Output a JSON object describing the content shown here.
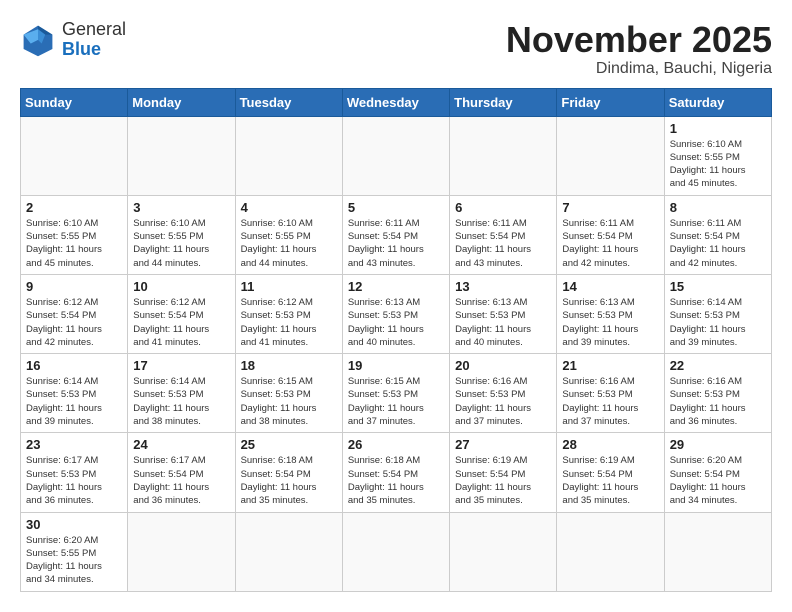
{
  "header": {
    "logo_general": "General",
    "logo_blue": "Blue",
    "month_year": "November 2025",
    "location": "Dindima, Bauchi, Nigeria"
  },
  "weekdays": [
    "Sunday",
    "Monday",
    "Tuesday",
    "Wednesday",
    "Thursday",
    "Friday",
    "Saturday"
  ],
  "weeks": [
    [
      {
        "day": "",
        "info": ""
      },
      {
        "day": "",
        "info": ""
      },
      {
        "day": "",
        "info": ""
      },
      {
        "day": "",
        "info": ""
      },
      {
        "day": "",
        "info": ""
      },
      {
        "day": "",
        "info": ""
      },
      {
        "day": "1",
        "info": "Sunrise: 6:10 AM\nSunset: 5:55 PM\nDaylight: 11 hours\nand 45 minutes."
      }
    ],
    [
      {
        "day": "2",
        "info": "Sunrise: 6:10 AM\nSunset: 5:55 PM\nDaylight: 11 hours\nand 45 minutes."
      },
      {
        "day": "3",
        "info": "Sunrise: 6:10 AM\nSunset: 5:55 PM\nDaylight: 11 hours\nand 44 minutes."
      },
      {
        "day": "4",
        "info": "Sunrise: 6:10 AM\nSunset: 5:55 PM\nDaylight: 11 hours\nand 44 minutes."
      },
      {
        "day": "5",
        "info": "Sunrise: 6:11 AM\nSunset: 5:54 PM\nDaylight: 11 hours\nand 43 minutes."
      },
      {
        "day": "6",
        "info": "Sunrise: 6:11 AM\nSunset: 5:54 PM\nDaylight: 11 hours\nand 43 minutes."
      },
      {
        "day": "7",
        "info": "Sunrise: 6:11 AM\nSunset: 5:54 PM\nDaylight: 11 hours\nand 42 minutes."
      },
      {
        "day": "8",
        "info": "Sunrise: 6:11 AM\nSunset: 5:54 PM\nDaylight: 11 hours\nand 42 minutes."
      }
    ],
    [
      {
        "day": "9",
        "info": "Sunrise: 6:12 AM\nSunset: 5:54 PM\nDaylight: 11 hours\nand 42 minutes."
      },
      {
        "day": "10",
        "info": "Sunrise: 6:12 AM\nSunset: 5:54 PM\nDaylight: 11 hours\nand 41 minutes."
      },
      {
        "day": "11",
        "info": "Sunrise: 6:12 AM\nSunset: 5:53 PM\nDaylight: 11 hours\nand 41 minutes."
      },
      {
        "day": "12",
        "info": "Sunrise: 6:13 AM\nSunset: 5:53 PM\nDaylight: 11 hours\nand 40 minutes."
      },
      {
        "day": "13",
        "info": "Sunrise: 6:13 AM\nSunset: 5:53 PM\nDaylight: 11 hours\nand 40 minutes."
      },
      {
        "day": "14",
        "info": "Sunrise: 6:13 AM\nSunset: 5:53 PM\nDaylight: 11 hours\nand 39 minutes."
      },
      {
        "day": "15",
        "info": "Sunrise: 6:14 AM\nSunset: 5:53 PM\nDaylight: 11 hours\nand 39 minutes."
      }
    ],
    [
      {
        "day": "16",
        "info": "Sunrise: 6:14 AM\nSunset: 5:53 PM\nDaylight: 11 hours\nand 39 minutes."
      },
      {
        "day": "17",
        "info": "Sunrise: 6:14 AM\nSunset: 5:53 PM\nDaylight: 11 hours\nand 38 minutes."
      },
      {
        "day": "18",
        "info": "Sunrise: 6:15 AM\nSunset: 5:53 PM\nDaylight: 11 hours\nand 38 minutes."
      },
      {
        "day": "19",
        "info": "Sunrise: 6:15 AM\nSunset: 5:53 PM\nDaylight: 11 hours\nand 37 minutes."
      },
      {
        "day": "20",
        "info": "Sunrise: 6:16 AM\nSunset: 5:53 PM\nDaylight: 11 hours\nand 37 minutes."
      },
      {
        "day": "21",
        "info": "Sunrise: 6:16 AM\nSunset: 5:53 PM\nDaylight: 11 hours\nand 37 minutes."
      },
      {
        "day": "22",
        "info": "Sunrise: 6:16 AM\nSunset: 5:53 PM\nDaylight: 11 hours\nand 36 minutes."
      }
    ],
    [
      {
        "day": "23",
        "info": "Sunrise: 6:17 AM\nSunset: 5:53 PM\nDaylight: 11 hours\nand 36 minutes."
      },
      {
        "day": "24",
        "info": "Sunrise: 6:17 AM\nSunset: 5:54 PM\nDaylight: 11 hours\nand 36 minutes."
      },
      {
        "day": "25",
        "info": "Sunrise: 6:18 AM\nSunset: 5:54 PM\nDaylight: 11 hours\nand 35 minutes."
      },
      {
        "day": "26",
        "info": "Sunrise: 6:18 AM\nSunset: 5:54 PM\nDaylight: 11 hours\nand 35 minutes."
      },
      {
        "day": "27",
        "info": "Sunrise: 6:19 AM\nSunset: 5:54 PM\nDaylight: 11 hours\nand 35 minutes."
      },
      {
        "day": "28",
        "info": "Sunrise: 6:19 AM\nSunset: 5:54 PM\nDaylight: 11 hours\nand 35 minutes."
      },
      {
        "day": "29",
        "info": "Sunrise: 6:20 AM\nSunset: 5:54 PM\nDaylight: 11 hours\nand 34 minutes."
      }
    ],
    [
      {
        "day": "30",
        "info": "Sunrise: 6:20 AM\nSunset: 5:55 PM\nDaylight: 11 hours\nand 34 minutes."
      },
      {
        "day": "",
        "info": ""
      },
      {
        "day": "",
        "info": ""
      },
      {
        "day": "",
        "info": ""
      },
      {
        "day": "",
        "info": ""
      },
      {
        "day": "",
        "info": ""
      },
      {
        "day": "",
        "info": ""
      }
    ]
  ]
}
